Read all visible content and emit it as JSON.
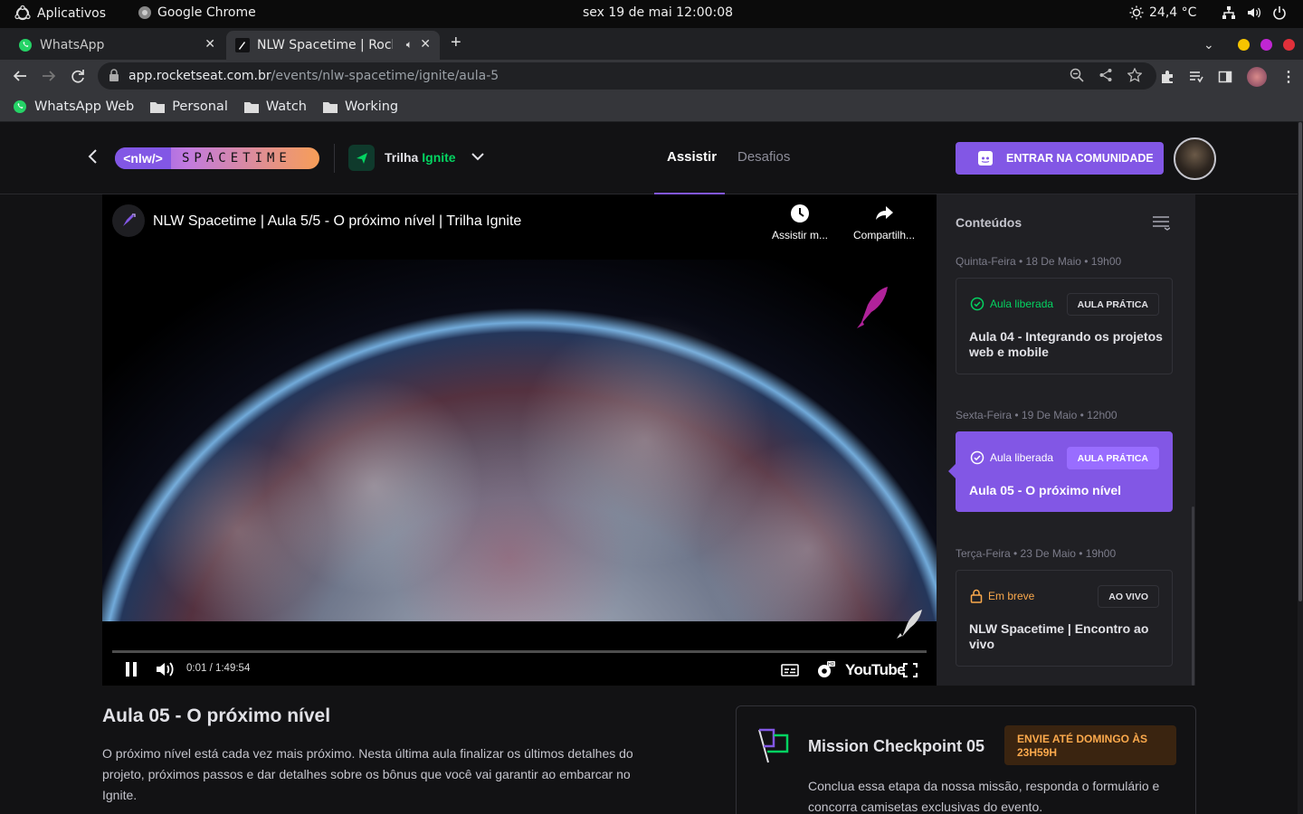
{
  "os": {
    "apps_label": "Aplicativos",
    "chrome_label": "Google Chrome",
    "clock": "sex 19 de mai  12:00:08",
    "weather": "24,4 °C"
  },
  "tabs": [
    {
      "title": "WhatsApp",
      "icon": "whatsapp-icon"
    },
    {
      "title": "NLW Spacetime | Rocketseat",
      "icon": "rocketseat-icon"
    }
  ],
  "address": {
    "host": "app.rocketseat.com.br",
    "path": "/events/nlw-spacetime/ignite/aula-5"
  },
  "bookmarks": [
    {
      "label": "WhatsApp Web",
      "icon": "whatsapp-icon"
    },
    {
      "label": "Personal",
      "icon": "folder-icon"
    },
    {
      "label": "Watch",
      "icon": "folder-icon"
    },
    {
      "label": "Working",
      "icon": "folder-icon"
    }
  ],
  "header": {
    "logo_left": "<nlw/>",
    "logo_right": "SPACETIME",
    "trilha_prefix": "Trilha",
    "trilha_name": "Ignite",
    "nav": [
      "Assistir",
      "Desafios"
    ],
    "community_button": "ENTRAR NA COMUNIDADE"
  },
  "video": {
    "title": "NLW Spacetime | Aula 5/5 - O próximo nível | Trilha Ignite",
    "watch_later": "Assistir m...",
    "share": "Compartilh...",
    "time": "0:01 / 1:49:54",
    "youtube_label": "YouTube"
  },
  "sidebar": {
    "title": "Conteúdos",
    "days": [
      {
        "label": "Quinta-Feira • 18 De Maio • 19h00",
        "status": "Aula liberada",
        "badge": "AULA PRÁTICA",
        "title": "Aula 04 - Integrando os projetos web e mobile"
      },
      {
        "label": "Sexta-Feira • 19 De Maio • 12h00",
        "status": "Aula liberada",
        "badge": "AULA PRÁTICA",
        "title": "Aula 05 - O próximo nível"
      },
      {
        "label": "Terça-Feira • 23 De Maio • 19h00",
        "status": "Em breve",
        "badge": "AO VIVO",
        "title": "NLW Spacetime | Encontro ao vivo"
      }
    ]
  },
  "lesson": {
    "heading": "Aula 05 - O próximo nível",
    "description": "O próximo nível está cada vez mais próximo. Nesta última aula finalizar os últimos detalhes do projeto, próximos passos e dar detalhes sobre os bônus que você vai garantir ao embarcar no Ignite."
  },
  "mission": {
    "title": "Mission Checkpoint 05",
    "badge": "ENVIE ATÉ DOMINGO ÀS 23H59H",
    "description": "Conclua essa etapa da nossa missão, responda o formulário e concorra camisetas exclusivas do evento."
  },
  "colors": {
    "brand": "#8257e5",
    "ignite_green": "#04d361",
    "released_green": "#04d361",
    "soon_orange": "#fba94c"
  }
}
